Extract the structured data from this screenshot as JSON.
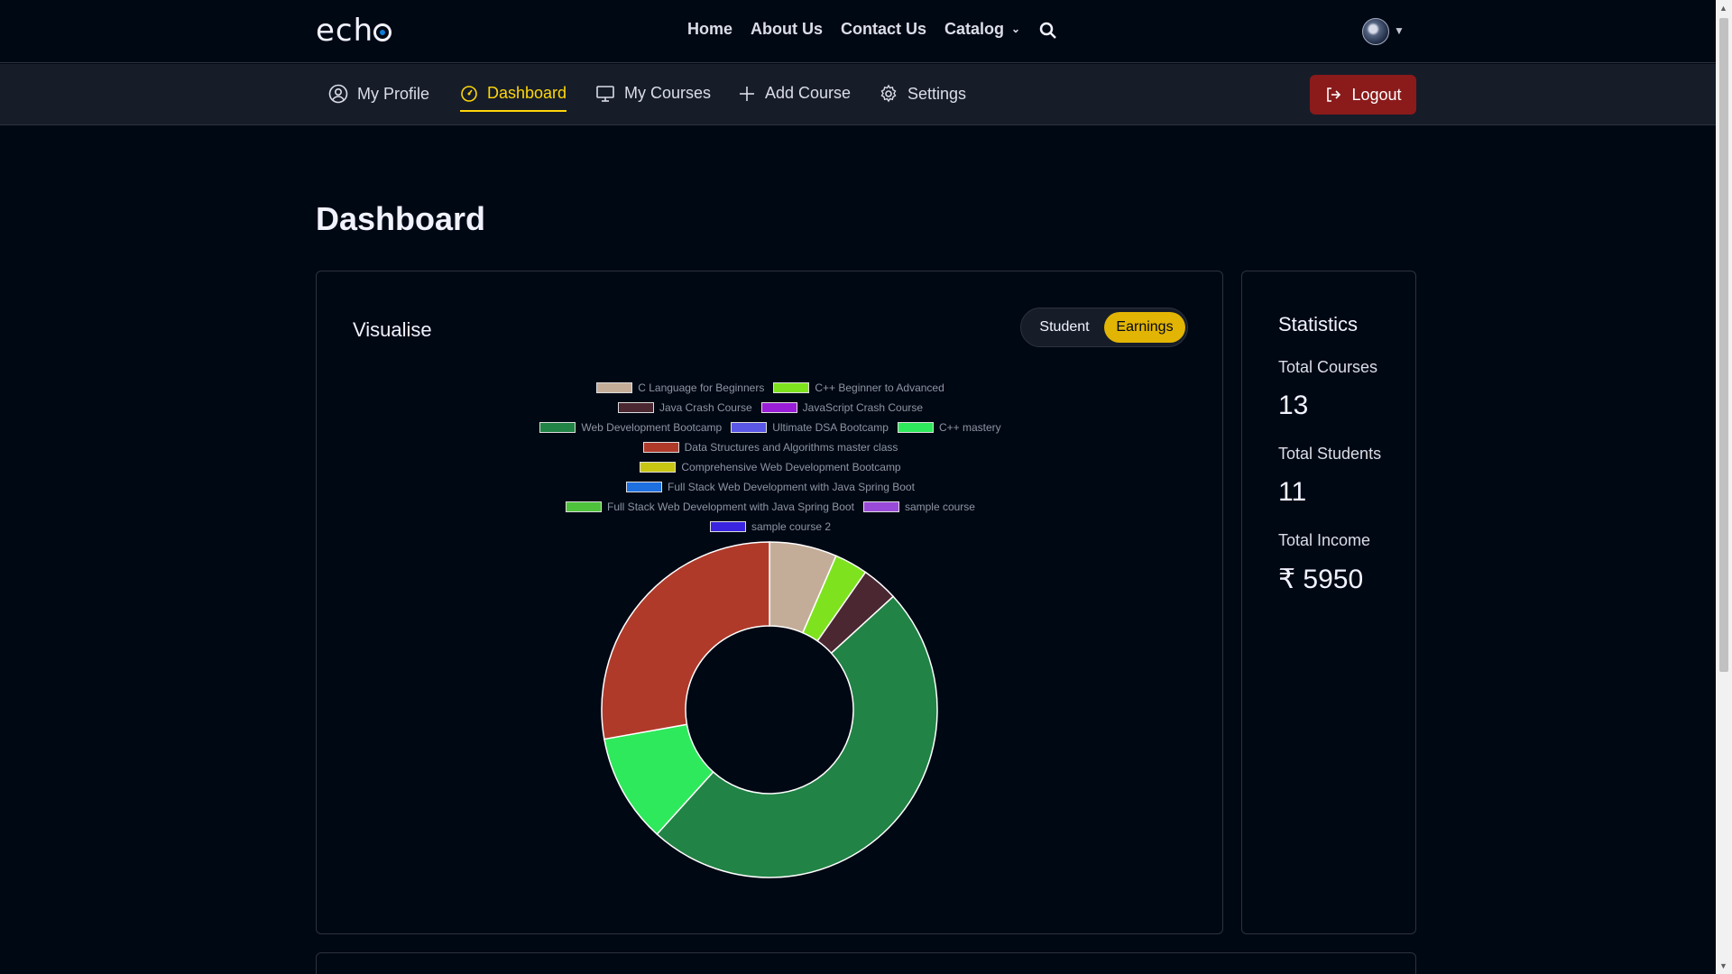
{
  "brand": {
    "name": "echo"
  },
  "topnav": {
    "links": [
      "Home",
      "About Us",
      "Contact Us",
      "Catalog"
    ],
    "icons": {
      "search": "search-icon",
      "avatar": "user-avatar",
      "catalog_caret": "chevron-down-icon"
    }
  },
  "subnav": {
    "items": [
      {
        "label": "My Profile",
        "icon": "user-circle-icon"
      },
      {
        "label": "Dashboard",
        "icon": "dashboard-icon",
        "active": true
      },
      {
        "label": "My Courses",
        "icon": "monitor-icon"
      },
      {
        "label": "Add Course",
        "icon": "plus-icon"
      },
      {
        "label": "Settings",
        "icon": "gear-icon"
      }
    ],
    "logout": {
      "label": "Logout",
      "icon": "logout-icon"
    }
  },
  "page": {
    "title": "Dashboard"
  },
  "visualise": {
    "title": "Visualise",
    "toggle": {
      "options": [
        "Student",
        "Earnings"
      ],
      "selected": "Earnings"
    }
  },
  "statistics": {
    "title": "Statistics",
    "items": [
      {
        "label": "Total Courses",
        "value": "13"
      },
      {
        "label": "Total Students",
        "value": "11"
      },
      {
        "label": "Total Income",
        "value": "₹ 5950"
      }
    ]
  },
  "colors": {
    "accent": "#ffd60a",
    "toggle_active": "#e2b404",
    "logout_bg": "#8b1a1a",
    "page_bg": "#000814",
    "subnav_bg": "#161d29"
  },
  "chart_data": {
    "type": "pie",
    "legend_placement": "top",
    "series": [
      {
        "name": "C Language for Beginners",
        "value": 6.5,
        "color": "#c4ad98"
      },
      {
        "name": "C++ Beginner to Advanced",
        "value": 3.2,
        "color": "#7ee31e"
      },
      {
        "name": "Java Crash Course",
        "value": 3.5,
        "color": "#4a2731"
      },
      {
        "name": "JavaScript Crash Course",
        "value": 0,
        "color": "#9a1ed8"
      },
      {
        "name": "Web Development Bootcamp",
        "value": 48.5,
        "color": "#218345"
      },
      {
        "name": "Ultimate DSA Bootcamp",
        "value": 0,
        "color": "#5a56e6"
      },
      {
        "name": "C++ mastery",
        "value": 10.5,
        "color": "#2ee95b"
      },
      {
        "name": "Data Structures and Algorithms master class",
        "value": 27.8,
        "color": "#b03a2a"
      },
      {
        "name": "Comprehensive Web Development Bootcamp",
        "value": 0,
        "color": "#c8c612"
      },
      {
        "name": "Full Stack Web Development with Java Spring Boot",
        "value": 0,
        "color": "#1e6fe0"
      },
      {
        "name": "Full Stack Web Development with Java Spring Boot",
        "value": 0,
        "color": "#4fc23c"
      },
      {
        "name": "sample course",
        "value": 0,
        "color": "#9a4ad8"
      },
      {
        "name": "sample course 2",
        "value": 0,
        "color": "#3a24e0"
      }
    ]
  }
}
